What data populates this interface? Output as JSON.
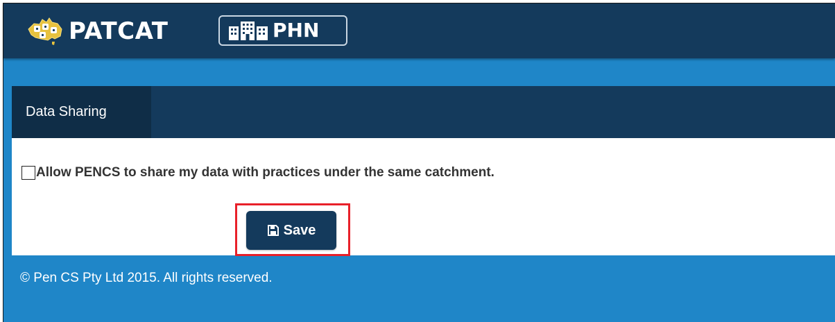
{
  "header": {
    "app_name": "PATCAT",
    "app_icon": "australia-map-icon",
    "network_label": "PHN",
    "network_icon": "buildings-icon",
    "colors": {
      "header_bg": "#143a5c",
      "accent_blue": "#1f86c8"
    }
  },
  "tabs": [
    {
      "label": "Data Sharing",
      "active": true
    }
  ],
  "sharing": {
    "checkbox_checked": false,
    "label": "Allow PENCS to share my data with practices under the same catchment."
  },
  "toolbar": {
    "save_label": "Save",
    "save_icon": "floppy-disk-icon",
    "highlight_color": "#e8202a"
  },
  "footer": {
    "copyright": "© Pen CS Pty Ltd 2015. All rights reserved."
  }
}
